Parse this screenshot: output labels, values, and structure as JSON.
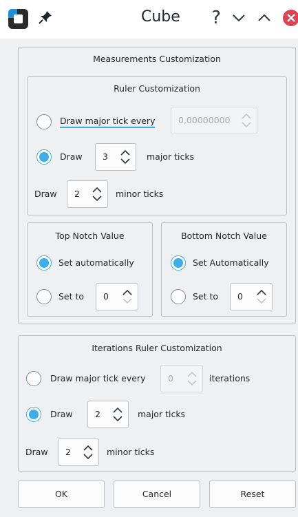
{
  "window": {
    "title": "Cube"
  },
  "measurements": {
    "title": "Measurements Customization",
    "ruler": {
      "title": "Ruler Customization",
      "every_label": "Draw major tick every",
      "every_value": "0,00000000",
      "draw_label": "Draw",
      "major_value": "3",
      "major_label": "major ticks",
      "minor_draw_label": "Draw",
      "minor_value": "2",
      "minor_label": "minor ticks"
    },
    "top_notch": {
      "title": "Top Notch Value",
      "auto_label": "Set automatically",
      "setto_label": "Set to",
      "value": "0"
    },
    "bottom_notch": {
      "title": "Bottom Notch Value",
      "auto_label": "Set Automatically",
      "setto_label": "Set to",
      "value": "0"
    }
  },
  "iterations": {
    "title": "Iterations Ruler Customization",
    "every_label": "Draw major tick every",
    "every_value": "0",
    "every_unit": "iterations",
    "draw_label": "Draw",
    "major_value": "2",
    "major_label": "major ticks",
    "minor_draw_label": "Draw",
    "minor_value": "2",
    "minor_label": "minor ticks"
  },
  "buttons": {
    "ok": "OK",
    "cancel": "Cancel",
    "reset": "Reset"
  },
  "colors": {
    "accent": "#3daee9",
    "close": "#da4453"
  },
  "icons": [
    "app-icon",
    "pin-icon",
    "help-icon",
    "chevron-down-icon",
    "chevron-up-icon",
    "close-icon"
  ]
}
